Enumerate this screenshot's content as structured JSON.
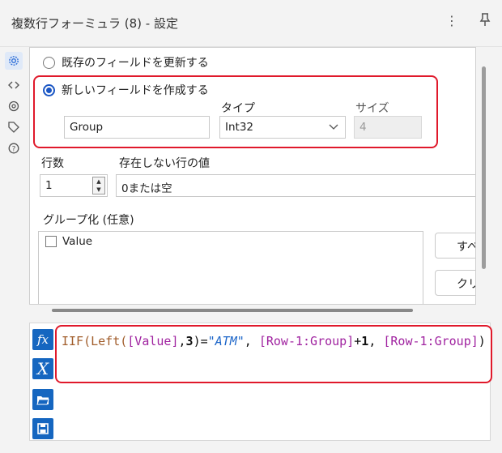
{
  "window": {
    "title": "複数行フォーミュラ (8) - 設定",
    "more_glyph": "⋮",
    "pin_glyph": "📌"
  },
  "sidebar": {
    "icons": [
      {
        "name": "gear-icon",
        "glyph": "⚙",
        "active": true
      },
      {
        "name": "code-icon",
        "glyph": "<>",
        "active": false
      },
      {
        "name": "connection-icon",
        "glyph": "◎",
        "active": false
      },
      {
        "name": "tag-icon",
        "glyph": "◇",
        "active": false
      },
      {
        "name": "help-icon",
        "glyph": "?",
        "active": false
      }
    ]
  },
  "config": {
    "update_existing_label": "既存のフィールドを更新する",
    "create_new_label": "新しいフィールドを作成する",
    "create_new_selected": true,
    "field_name_value": "Group",
    "type_label": "タイプ",
    "type_value": "Int32",
    "size_label": "サイズ",
    "size_value": "4",
    "rows_label": "行数",
    "rows_value": "1",
    "missing_label": "存在しない行の値",
    "missing_value": "0または空",
    "group_by_label": "グループ化 (任意)",
    "group_by_items": [
      {
        "label": "Value",
        "checked": false
      }
    ],
    "select_all_label": "すべて選択",
    "clear_label": "クリア"
  },
  "expression": {
    "tokens": [
      {
        "t": "IIF(Left(",
        "c": "fn"
      },
      {
        "t": "[Value]",
        "c": "fld"
      },
      {
        "t": ",",
        "c": "op"
      },
      {
        "t": "3",
        "c": "num"
      },
      {
        "t": ")=",
        "c": "op"
      },
      {
        "t": "\"ATM\"",
        "c": "str"
      },
      {
        "t": ", ",
        "c": "op"
      },
      {
        "t": "[Row-1:Group]",
        "c": "fld"
      },
      {
        "t": "+",
        "c": "op"
      },
      {
        "t": "1",
        "c": "num"
      },
      {
        "t": ", ",
        "c": "op"
      },
      {
        "t": "[Row-1:Group]",
        "c": "fld"
      },
      {
        "t": ")",
        "c": "op"
      }
    ]
  },
  "editor_tools": [
    {
      "name": "functions-icon",
      "glyph": "fx"
    },
    {
      "name": "variables-icon",
      "glyph": "X"
    },
    {
      "name": "open-expression-icon",
      "glyph": "▬"
    },
    {
      "name": "save-expression-icon",
      "glyph": "▣"
    }
  ],
  "colors": {
    "accent": "#1a56c4",
    "highlight": "#e0192b",
    "tool_blue": "#1566c0"
  }
}
